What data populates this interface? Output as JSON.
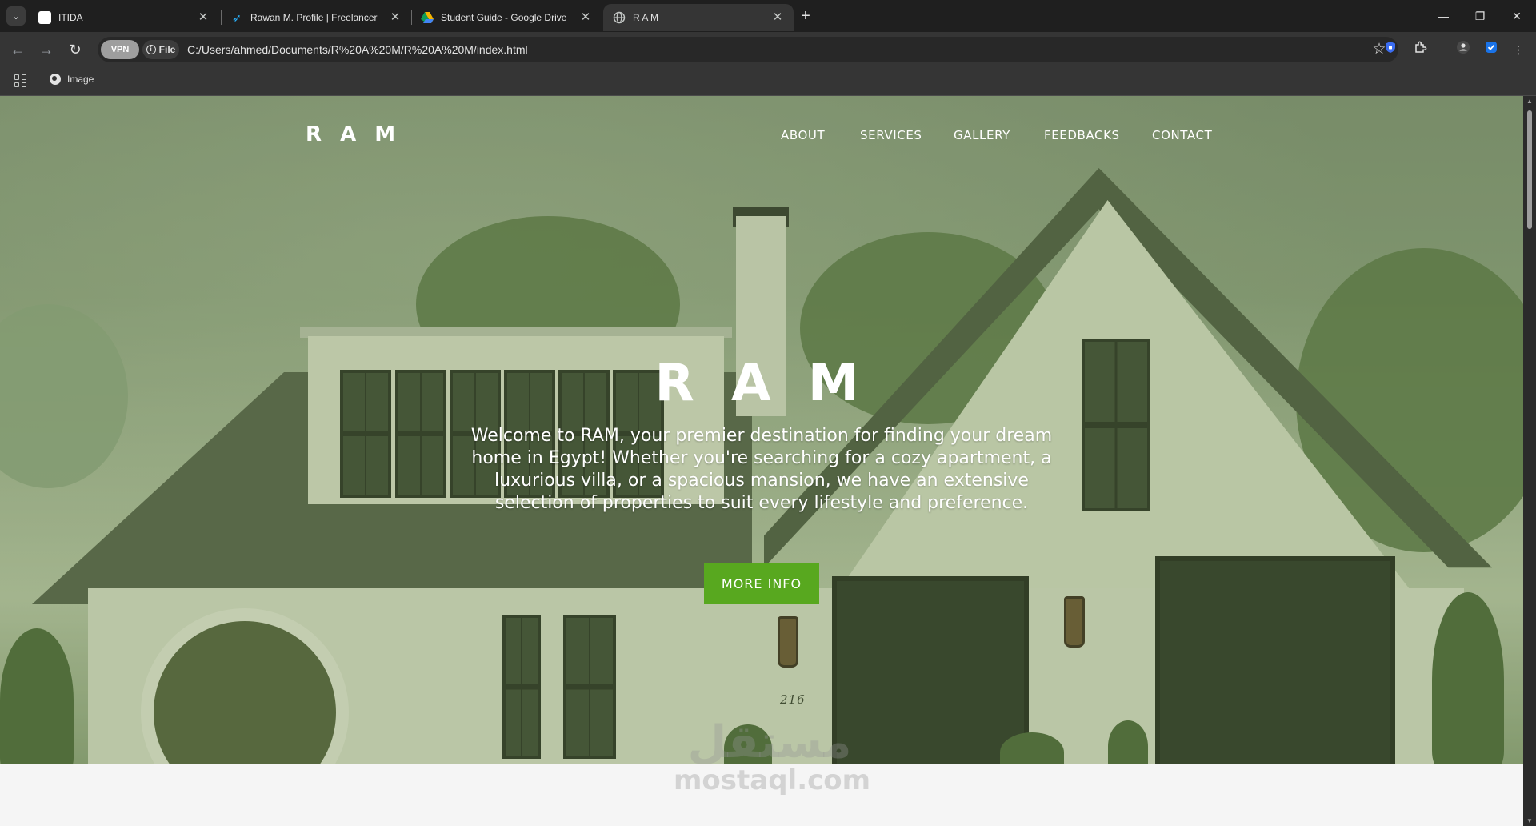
{
  "browser": {
    "tabs": [
      {
        "title": "ITIDA",
        "favicon_color": "#ffffff"
      },
      {
        "title": "Rawan M. Profile | Freelancer",
        "favicon_color": "#29b2fe"
      },
      {
        "title": "Student Guide - Google Drive",
        "favicon_color": "#f4b400"
      },
      {
        "title": "R A M",
        "favicon_color": "#c4c7c5"
      }
    ],
    "active_tab": 3,
    "vpn_label": "VPN",
    "url_chip": "File",
    "url": "C:/Users/ahmed/Documents/R%20A%20M/R%20A%20M/index.html",
    "bookmarks": [
      {
        "label": "Image"
      }
    ]
  },
  "site": {
    "brand": "R A M",
    "nav": [
      "ABOUT",
      "SERVICES",
      "GALLERY",
      "FEEDBACKS",
      "CONTACT"
    ],
    "hero": {
      "title": "R A M",
      "text": "Welcome to RAM, your premier destination for finding your dream home in Egypt! Whether you're searching for a cozy apartment, a luxurious villa, or a spacious mansion, we have an extensive selection of properties to suit every lifestyle and preference.",
      "cta": "MORE INFO"
    },
    "house_number": "216",
    "accent_color": "#58a81f"
  },
  "watermark": {
    "arabic": "مستقل",
    "latin": "mostaql.com"
  }
}
